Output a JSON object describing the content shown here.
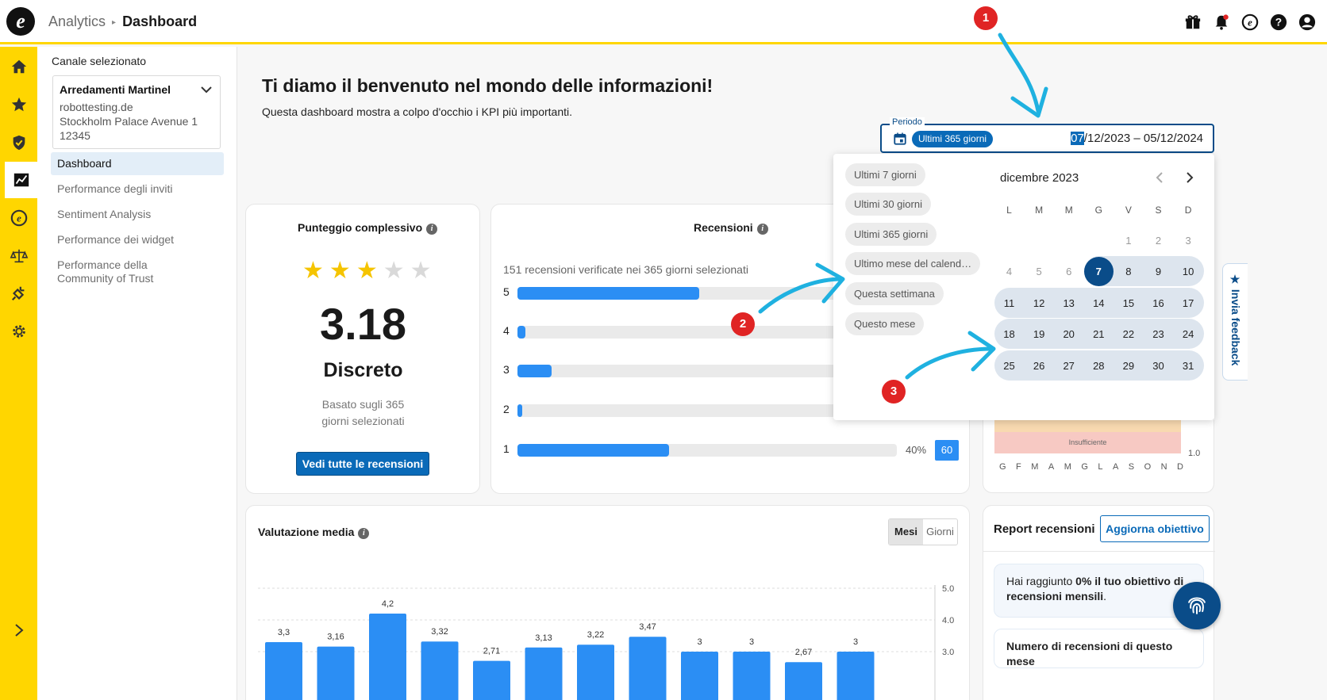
{
  "header": {
    "breadcrumb_section": "Analytics",
    "breadcrumb_page": "Dashboard",
    "icons": [
      "gift-icon",
      "bell-icon",
      "brand-e-icon",
      "help-icon",
      "user-icon"
    ]
  },
  "rail": {
    "icons": [
      "home-icon",
      "star-icon",
      "shield-check-icon",
      "analytics-chart-icon",
      "brand-e-icon",
      "scales-icon",
      "plug-icon",
      "gear-icon",
      "chevron-right-icon"
    ],
    "active_index": 3
  },
  "sidebar": {
    "channel_label": "Canale selezionato",
    "channel": {
      "name": "Arredamenti Martinel",
      "domain": "robottesting.de",
      "address1": "Stockholm Palace Avenue 1",
      "address2": "12345"
    },
    "nav": [
      {
        "label": "Dashboard"
      },
      {
        "label": "Performance degli inviti"
      },
      {
        "label": "Sentiment Analysis"
      },
      {
        "label": "Performance dei widget"
      },
      {
        "label": "Performance della Community of Trust"
      }
    ]
  },
  "welcome": {
    "title": "Ti diamo il benvenuto nel mondo delle informazioni!",
    "subtitle": "Questa dashboard mostra a colpo d'occhio i KPI più importanti."
  },
  "score_card": {
    "title": "Punteggio complessivo",
    "stars_filled": 3,
    "stars_total": 5,
    "score": "3.18",
    "rating": "Discreto",
    "based_line1": "Basato sugli 365",
    "based_line2": "giorni selezionati",
    "button": "Vedi tutte le recensioni"
  },
  "reviews_card": {
    "title": "Recensioni",
    "subtitle": "151 recensioni verificate nei 365 giorni selezionati",
    "rows": [
      {
        "label": "5",
        "fill": 0.48
      },
      {
        "label": "4",
        "fill": 0.02
      },
      {
        "label": "3",
        "fill": 0.09
      },
      {
        "label": "2",
        "fill": 0.01
      },
      {
        "label": "1",
        "fill": 0.4,
        "pct": "40%",
        "count": "60"
      }
    ]
  },
  "period": {
    "label": "Periodo",
    "chip": "Ultimi 365 giorni",
    "date_highlight": "07",
    "date_rest": "/12/2023 – 05/12/2024"
  },
  "datepicker": {
    "presets": [
      "Ultimi 7 giorni",
      "Ultimi 30 giorni",
      "Ultimi 365 giorni",
      "Ultimo mese del calend…",
      "Questa settimana",
      "Questo mese"
    ],
    "month": "dicembre 2023",
    "weekdays": [
      "L",
      "M",
      "M",
      "G",
      "V",
      "S",
      "D"
    ],
    "weeks": [
      [
        "",
        "",
        "",
        "",
        "1",
        "2",
        "3"
      ],
      [
        "4",
        "5",
        "6",
        "7",
        "8",
        "9",
        "10"
      ],
      [
        "11",
        "12",
        "13",
        "14",
        "15",
        "16",
        "17"
      ],
      [
        "18",
        "19",
        "20",
        "21",
        "22",
        "23",
        "24"
      ],
      [
        "25",
        "26",
        "27",
        "28",
        "29",
        "30",
        "31"
      ]
    ],
    "selected": "7"
  },
  "mini_chart": {
    "band_label": "Insufficiente",
    "y_label": "1.0",
    "months": [
      "G",
      "F",
      "M",
      "A",
      "M",
      "G",
      "L",
      "A",
      "S",
      "O",
      "N",
      "D"
    ]
  },
  "feedback_tab": "Invia feedback",
  "avg_card": {
    "title": "Valutazione media",
    "toggle": [
      "Mesi",
      "Giorni"
    ],
    "toggle_active": 0
  },
  "chart_data": {
    "type": "bar",
    "title": "Valutazione media",
    "values": [
      3.3,
      3.16,
      4.2,
      3.32,
      2.71,
      3.13,
      3.22,
      3.47,
      3,
      3,
      2.67,
      3
    ],
    "value_labels": [
      "3,3",
      "3,16",
      "4,2",
      "3,32",
      "2,71",
      "3,13",
      "3,22",
      "3,47",
      "3",
      "3",
      "2,67",
      "3"
    ],
    "y_ticks": [
      "5.0",
      "4.0",
      "3.0"
    ],
    "ylim": [
      1,
      5
    ],
    "grid": true,
    "bar_color": "#2b8ef4"
  },
  "report_card": {
    "title": "Report recensioni",
    "button": "Aggiorna obiettivo",
    "goal_pre": "Hai raggiunto ",
    "goal_bold": "0% il tuo obiettivo di recensioni mensili",
    "goal_post": ".",
    "month_count": "Numero di recensioni di questo mese"
  },
  "annotations": [
    "1",
    "2",
    "3"
  ],
  "colors": {
    "accent_yellow": "#ffd600",
    "primary_blue": "#0a6ab8",
    "dark_blue": "#0a4c89",
    "bar_blue": "#2b8ef4",
    "annotation_red": "#e02424",
    "arrow_cyan": "#1fb1e0"
  }
}
